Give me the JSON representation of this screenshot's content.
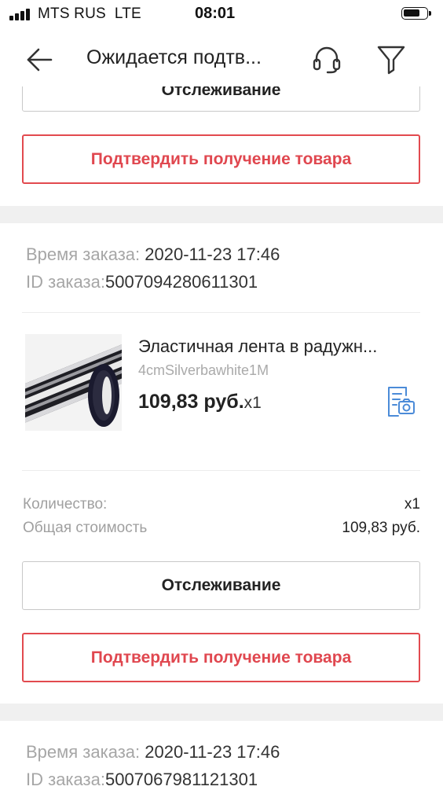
{
  "status_bar": {
    "carrier": "MTS RUS",
    "network": "LTE",
    "time": "08:01"
  },
  "nav": {
    "title": "Ожидается подтв...",
    "back_icon": "back-arrow-icon",
    "support_icon": "headset-icon",
    "filter_icon": "filter-icon"
  },
  "colors": {
    "accent_red": "#e0474f",
    "separator": "#f0f0f0",
    "muted_text": "#a6a6a6",
    "snapshot_icon": "#4b8bd8"
  },
  "orders": [
    {
      "tracking_label": "Отслеживание",
      "confirm_label": "Подтвердить получение товара"
    },
    {
      "time_label": "Время заказа:",
      "time_value": "2020-11-23 17:46",
      "id_label": "ID заказа:",
      "id_value": "5007094280611301",
      "product": {
        "title": "Эластичная лента в радужн...",
        "sku": "4cmSilverbawhite1M",
        "price": "109,83 руб.",
        "qty": "x1",
        "snapshot_icon": "snapshot-icon"
      },
      "summary": {
        "quantity_label": "Количество:",
        "quantity_value": "x1",
        "total_label": "Общая стоимость",
        "total_value": "109,83 руб."
      },
      "tracking_label": "Отслеживание",
      "confirm_label": "Подтвердить получение товара"
    },
    {
      "time_label": "Время заказа:",
      "time_value": "2020-11-23 17:46",
      "id_label": "ID заказа:",
      "id_value": "5007067981121301"
    }
  ]
}
